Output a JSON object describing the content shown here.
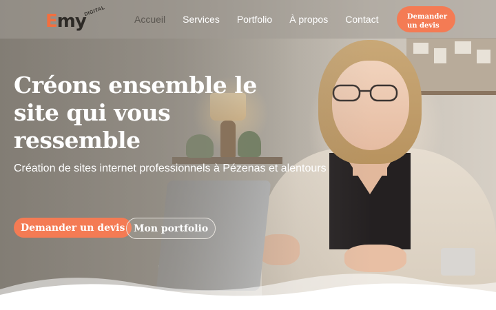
{
  "brand": {
    "logo_text": "Emy",
    "logo_sub": "DIGITAL",
    "accent_color": "#f47b54"
  },
  "nav": {
    "items": [
      {
        "label": "Accueil",
        "active": true
      },
      {
        "label": "Services",
        "active": false
      },
      {
        "label": "Portfolio",
        "active": false
      },
      {
        "label": "À propos",
        "active": false
      },
      {
        "label": "Contact",
        "active": false
      }
    ],
    "cta_label": "Demander un devis"
  },
  "hero": {
    "headline": "Créons ensemble le site qui vous ressemble",
    "subtitle": "Création de sites internet professionnels à Pézenas et alentours",
    "primary_button": "Demander un devis",
    "secondary_button": "Mon portfolio"
  }
}
